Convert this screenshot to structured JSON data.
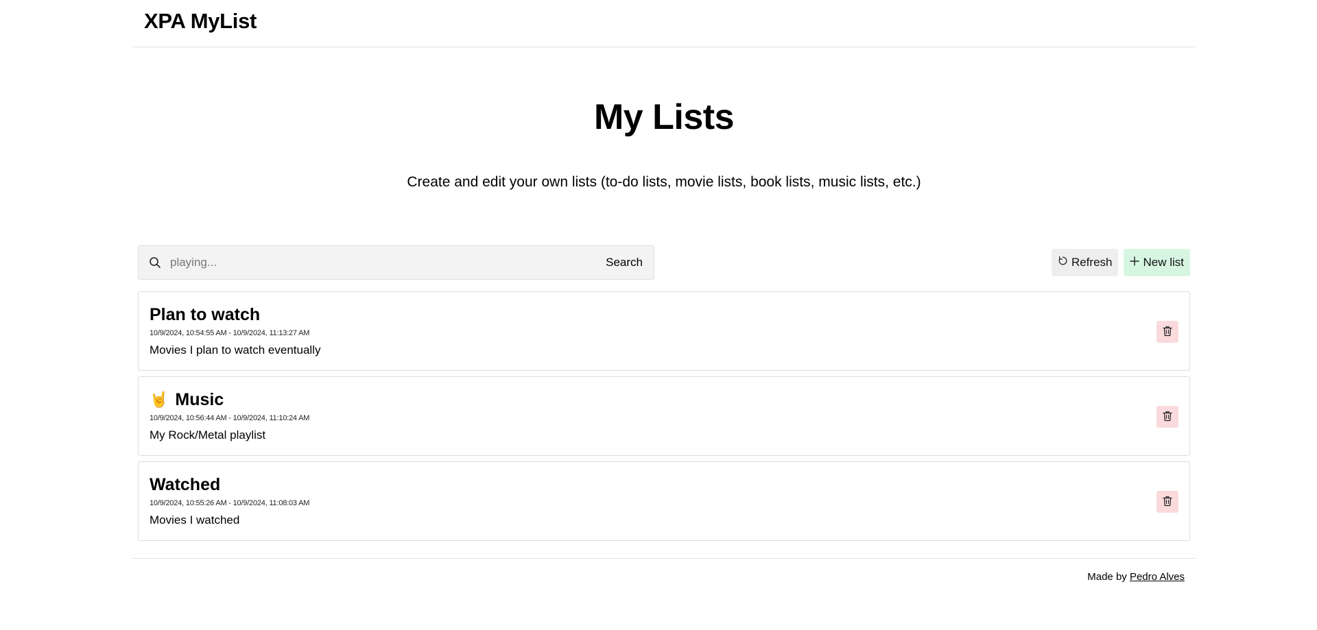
{
  "header": {
    "app_title": "XPA MyList"
  },
  "hero": {
    "title": "My Lists",
    "subtitle": "Create and edit your own lists (to-do lists, movie lists, book lists, music lists, etc.)"
  },
  "search": {
    "placeholder": "playing...",
    "value": "",
    "button_label": "Search",
    "icon": "search-icon"
  },
  "actions": {
    "refresh_label": "Refresh",
    "refresh_icon": "refresh-icon",
    "new_list_label": "New list",
    "new_list_icon": "plus-icon"
  },
  "lists": [
    {
      "emoji": "",
      "title": "Plan to watch",
      "dates": "10/9/2024, 10:54:55 AM - 10/9/2024, 11:13:27 AM",
      "description": "Movies I plan to watch eventually"
    },
    {
      "emoji": "🤘",
      "title": "Music",
      "dates": "10/9/2024, 10:56:44 AM - 10/9/2024, 11:10:24 AM",
      "description": "My Rock/Metal playlist"
    },
    {
      "emoji": "",
      "title": "Watched",
      "dates": "10/9/2024, 10:55:26 AM - 10/9/2024, 11:08:03 AM",
      "description": "Movies I watched"
    }
  ],
  "footer": {
    "made_by_prefix": "Made by",
    "author_link": "Pedro Alves"
  },
  "colors": {
    "new_list_bg": "#d7f6e1",
    "refresh_bg": "#eeeeee",
    "delete_bg": "#fadadb",
    "search_bg": "#f3f3f3"
  }
}
